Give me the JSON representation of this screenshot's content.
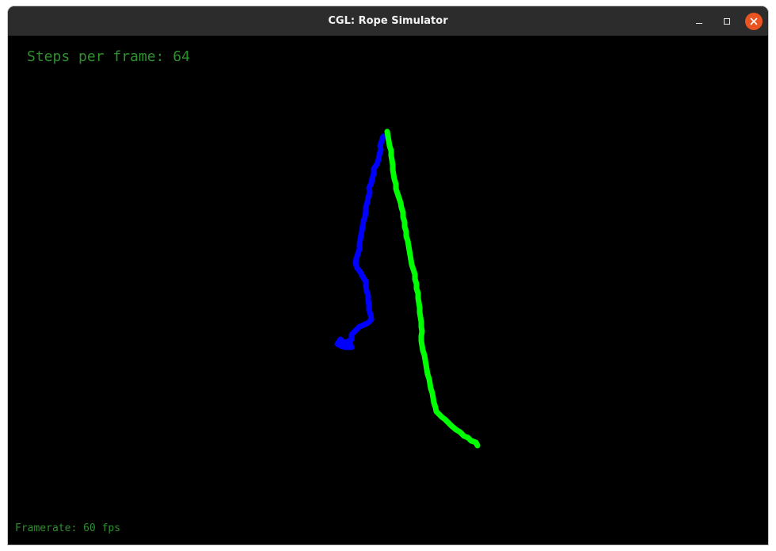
{
  "window": {
    "title": "CGL: Rope Simulator",
    "controls": {
      "minimize_icon": "minimize-icon",
      "maximize_icon": "maximize-icon",
      "close_icon": "close-icon",
      "close_color": "#e95420"
    }
  },
  "overlay": {
    "steps_text": "Steps per frame: 64",
    "framerate_text": "Framerate: 60 fps",
    "text_color": "#2e8f2e"
  },
  "scene": {
    "background": "#000000",
    "ropes": [
      {
        "name": "blue-rope",
        "color": "#0000ff"
      },
      {
        "name": "green-rope",
        "color": "#00ff00"
      }
    ]
  }
}
